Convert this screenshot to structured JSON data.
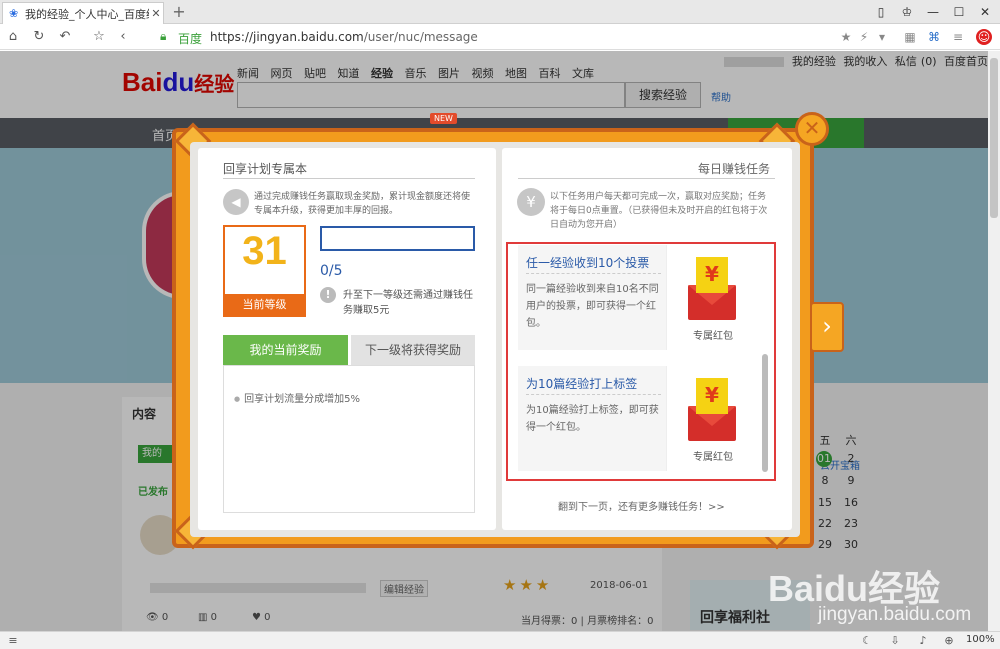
{
  "browser": {
    "tab_title": "我的经验_个人中心_百度经验",
    "site_label": "百度",
    "url_host": "https://jingyan.baidu.com",
    "url_path": "/user/nuc/message",
    "zoom": "100%"
  },
  "header": {
    "top_links": [
      "我的经验",
      "我的收入",
      "私信",
      "(0)",
      "百度首页"
    ],
    "logo_bai": "Bai",
    "logo_du": "du",
    "logo_jy": "经验",
    "channels": [
      "新闻",
      "网页",
      "贴吧",
      "知道",
      "经验",
      "音乐",
      "图片",
      "视频",
      "地图",
      "百科",
      "文库"
    ],
    "search_button": "搜索经验",
    "help": "帮助",
    "nav_home": "首页"
  },
  "background": {
    "content_header": "内容",
    "tab_label": "我的",
    "published": "已发布 (",
    "article_tag": "编辑经验",
    "article_date": "2018-06-01",
    "views": "0",
    "votes": "0",
    "likes": "0",
    "rank_text": "当月得票：0 | 月票榜排名：0",
    "treasure_link": "去开宝箱",
    "cal_headers": [
      "五",
      "六"
    ],
    "cal_rows": [
      [
        "01",
        "2"
      ],
      [
        "8",
        "9"
      ],
      [
        "15",
        "16"
      ],
      [
        "22",
        "23"
      ],
      [
        "29",
        "30"
      ]
    ],
    "bonus_text": "回享福利社"
  },
  "modal": {
    "new_badge": "NEW",
    "left": {
      "title": "回享计划专属本",
      "description": "通过完成赚钱任务赢取现金奖励，累计现金额度还将使专属本升级，获得更加丰厚的回报。",
      "level": "31",
      "level_label": "当前等级",
      "progress_value": 0,
      "progress_text": "0/5",
      "hint": "升至下一等级还需通过赚钱任务赚取5元",
      "tab_current": "我的当前奖励",
      "tab_next": "下一级将获得奖励",
      "rewards": [
        "回享计划流量分成增加5%"
      ]
    },
    "right": {
      "title": "每日赚钱任务",
      "description": "以下任务用户每天都可完成一次，赢取对应奖励；任务将于每日0点重置。（已获得但未及时开启的红包将于次日自动为您开启）",
      "tasks": [
        {
          "name": "任一经验收到10个投票",
          "desc": "同一篇经验收到来自10名不同用户的投票，即可获得一个红包。",
          "reward": "专属红包"
        },
        {
          "name": "为10篇经验打上标签",
          "desc": "为10篇经验打上标签，即可获得一个红包。",
          "reward": "专属红包"
        }
      ],
      "next_page": "翻到下一页，还有更多赚钱任务！>>"
    }
  },
  "watermark": {
    "logo": "Baidu经验",
    "url": "jingyan.baidu.com"
  },
  "colors": {
    "accent_orange": "#f29b1d",
    "brand_green": "#6ab84a",
    "link_blue": "#2a5aa8",
    "highlight_red": "#e03a3a"
  }
}
